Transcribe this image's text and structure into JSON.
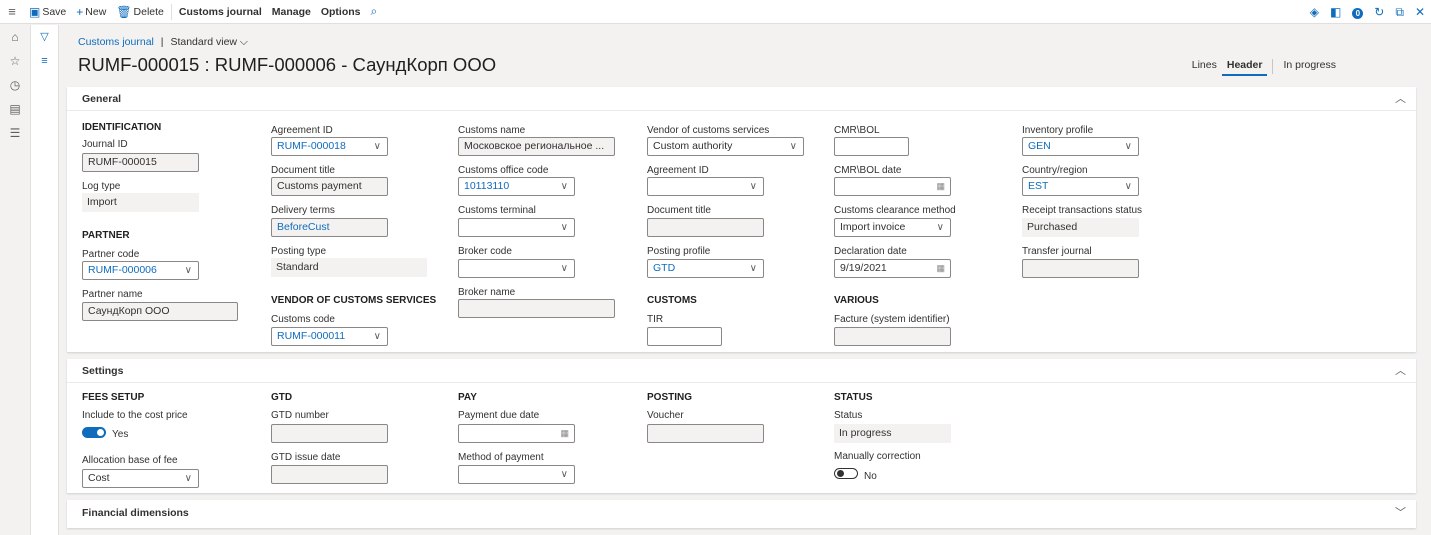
{
  "toolbar": {
    "save": "Save",
    "new": "New",
    "delete": "Delete",
    "customs_journal": "Customs journal",
    "manage": "Manage",
    "options": "Options"
  },
  "breadcrumb": {
    "link": "Customs journal",
    "separator": "|",
    "view": "Standard view"
  },
  "page": {
    "title": "RUMF-000015 : RUMF-000006 - СаундКорп ООО"
  },
  "tabs": {
    "lines": "Lines",
    "header": "Header",
    "in_progress": "In progress"
  },
  "notification_count": "0",
  "general": {
    "title": "General",
    "identification": "IDENTIFICATION",
    "journal_id_label": "Journal ID",
    "journal_id": "RUMF-000015",
    "log_type_label": "Log type",
    "log_type": "Import",
    "partner": "PARTNER",
    "partner_code_label": "Partner code",
    "partner_code": "RUMF-000006",
    "partner_name_label": "Partner name",
    "partner_name": "СаундКорп ООО",
    "agreement_id_label": "Agreement ID",
    "agreement_id": "RUMF-000018",
    "document_title_label": "Document title",
    "document_title": "Customs payment",
    "delivery_terms_label": "Delivery terms",
    "delivery_terms": "BeforeCust",
    "posting_type_label": "Posting type",
    "posting_type": "Standard",
    "vendor_customs_services": "VENDOR OF CUSTOMS SERVICES",
    "customs_code_label": "Customs code",
    "customs_code": "RUMF-000011",
    "customs_name_label": "Customs name",
    "customs_name": "Московское региональное ...",
    "customs_office_code_label": "Customs office code",
    "customs_office_code": "10113110",
    "customs_terminal_label": "Customs terminal",
    "customs_terminal": "",
    "broker_code_label": "Broker code",
    "broker_code": "",
    "broker_name_label": "Broker name",
    "broker_name": "",
    "vendor_services_label": "Vendor of customs services",
    "vendor_services": "Custom authority",
    "agreement_id2_label": "Agreement ID",
    "agreement_id2": "",
    "document_title2_label": "Document title",
    "document_title2": "",
    "posting_profile_label": "Posting profile",
    "posting_profile": "GTD",
    "customs": "CUSTOMS",
    "tir_label": "TIR",
    "tir": "",
    "cmr_bol_label": "CMR\\BOL",
    "cmr_bol": "",
    "cmr_bol_date_label": "CMR\\BOL date",
    "cmr_bol_date": "",
    "clearance_method_label": "Customs clearance method",
    "clearance_method": "Import invoice",
    "declaration_date_label": "Declaration date",
    "declaration_date": "9/19/2021",
    "various": "VARIOUS",
    "facture_label": "Facture (system identifier)",
    "facture": "",
    "inventory_profile_label": "Inventory profile",
    "inventory_profile": "GEN",
    "country_label": "Country/region",
    "country": "EST",
    "receipt_status_label": "Receipt transactions status",
    "receipt_status": "Purchased",
    "transfer_journal_label": "Transfer journal",
    "transfer_journal": ""
  },
  "settings": {
    "title": "Settings",
    "fees_setup": "FEES SETUP",
    "include_cost_label": "Include to the cost price",
    "include_cost": "Yes",
    "allocation_label": "Allocation base of fee",
    "allocation": "Cost",
    "gtd": "GTD",
    "gtd_number_label": "GTD number",
    "gtd_number": "",
    "gtd_issue_date_label": "GTD issue date",
    "gtd_issue_date": "",
    "pay": "PAY",
    "payment_due_label": "Payment due date",
    "payment_due": "",
    "method_payment_label": "Method of payment",
    "method_payment": "",
    "posting": "POSTING",
    "voucher_label": "Voucher",
    "voucher": "",
    "status_group": "STATUS",
    "status_label": "Status",
    "status": "In progress",
    "manual_correction_label": "Manually correction",
    "manual_correction": "No"
  },
  "financial": {
    "title": "Financial dimensions"
  }
}
